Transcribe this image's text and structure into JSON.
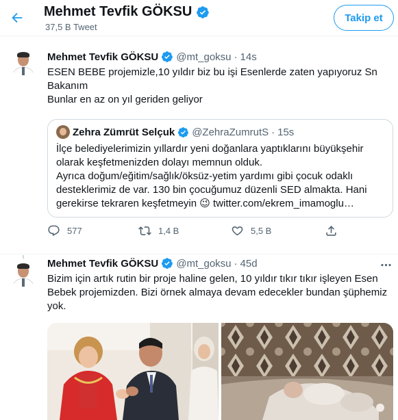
{
  "header": {
    "name": "Mehmet Tevfik GÖKSU",
    "tweet_count": "37,5 B Tweet",
    "follow_label": "Takip et"
  },
  "tweet1": {
    "name": "Mehmet Tevfik GÖKSU",
    "handle": "@mt_goksu",
    "dot": "·",
    "time": "14s",
    "lines": [
      "ESEN BEBE projemizle,10 yıldır biz bu işi Esenlerde zaten yapıyoruz Sn",
      "Bakanım",
      "Bunlar en az on yıl geriden geliyor"
    ],
    "quote": {
      "name": "Zehra Zümrüt Selçuk",
      "handle": "@ZehraZumrutS",
      "dot": "·",
      "time": "15s",
      "lines": [
        "İlçe belediyelerimizin yıllardır yeni doğanlara yaptıklarını büyükşehir",
        "olarak keşfetmenizden dolayı memnun olduk.",
        "Ayrıca doğum/eğitim/sağlık/öksüz-yetim yardımı gibi çocuk odaklı",
        "desteklerimiz de var. 130 bin çocuğumuz düzenli SED almakta. Hani",
        "gerekirse tekraren keşfetmeyin 😉 twitter.com/ekrem_imamoglu…"
      ]
    },
    "actions": {
      "replies": "577",
      "retweets": "1,4 B",
      "likes": "5,5 B"
    }
  },
  "tweet2": {
    "name": "Mehmet Tevfik GÖKSU",
    "handle": "@mt_goksu",
    "dot": "·",
    "time": "45d",
    "lines": [
      "Bizim için artık rutin bir proje haline gelen, 10 yıldır tıkır tıkır işleyen Esen",
      "Bebek projemizden. Bizi örnek almaya devam edecekler bundan şüphemiz",
      "yok."
    ]
  },
  "colors": {
    "accent": "#1d9bf0",
    "verified": "#1d9bf0",
    "secondary_text": "#536471",
    "border": "#cfd9de"
  },
  "icons": {
    "back": "arrow-left-icon",
    "verified": "verified-badge-icon",
    "reply": "reply-icon",
    "retweet": "retweet-icon",
    "like": "heart-icon",
    "share": "share-icon",
    "more": "more-horizontal-icon"
  }
}
